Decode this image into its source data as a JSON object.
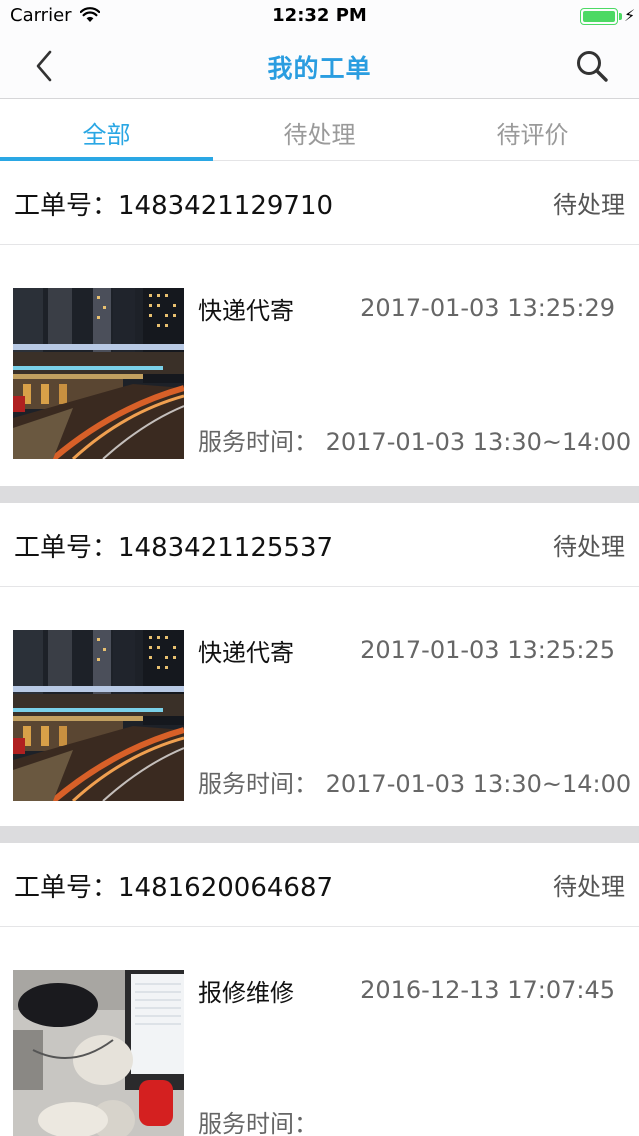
{
  "status_bar": {
    "carrier": "Carrier",
    "time": "12:32 PM",
    "battery_level": 1.0
  },
  "nav": {
    "title": "我的工单",
    "back_icon": "chevron-left-icon",
    "search_icon": "search-icon"
  },
  "tabs": [
    {
      "label": "全部",
      "active": true
    },
    {
      "label": "待处理",
      "active": false
    },
    {
      "label": "待评价",
      "active": false
    }
  ],
  "orders": [
    {
      "order_no": "工单号：1483421129710",
      "status": "待处理",
      "service": "快递代寄",
      "created_at": "2017-01-03 13:25:29",
      "service_time": "服务时间：  2017-01-03 13:30~14:00"
    },
    {
      "order_no": "工单号：1483421125537",
      "status": "待处理",
      "service": "快递代寄",
      "created_at": "2017-01-03 13:25:25",
      "service_time": "服务时间：  2017-01-03 13:30~14:00"
    },
    {
      "order_no": "工单号：1481620064687",
      "status": "待处理",
      "service": "报修维修",
      "created_at": "2016-12-13 17:07:45",
      "service_time": "服务时间："
    }
  ],
  "colors": {
    "accent": "#2aa7e4",
    "title": "#2a9de0",
    "separator": "#dcdcde"
  }
}
